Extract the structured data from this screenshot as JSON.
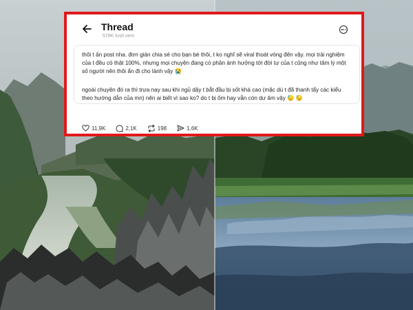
{
  "header": {
    "back_icon": "arrow-left-icon",
    "title": "Thread",
    "views": "578K lượt xem",
    "more_icon": "more-circle-icon"
  },
  "post": {
    "paragraph1": "thôi t ấn post nha. đơn giản chia sẻ cho bạn bè thôi, t ko nghĩ sẽ viral thoát vòng đến vậy. mọi trải nghiệm của t đều có thật 100%, nhưng mọi chuyện đang có phần ảnh hưởng tới đời tư của t cũng như tâm lý một số người nên thôi ẩn đi cho lành vậy 😭",
    "paragraph2": "ngoài chuyện đó ra thì trưa nay sau khi ngủ dậy t bắt đầu bị sốt khá cao (mặc dù t đã thanh tẩy các kiểu theo hướng dẫn của mn) nên ai biết vì sao ko? do t bị ốm hay vẫn còn dư âm vậy 😓 😓"
  },
  "stats": {
    "likes": "11,9K",
    "comments": "2,1K",
    "reposts": "198",
    "shares": "1,6K",
    "icons": [
      "heart-icon",
      "comment-icon",
      "repost-icon",
      "share-icon"
    ]
  },
  "colors": {
    "frame_border": "#e0191b",
    "card_bg": "#ffffff",
    "text": "#222222",
    "muted": "#9a9a9a"
  }
}
